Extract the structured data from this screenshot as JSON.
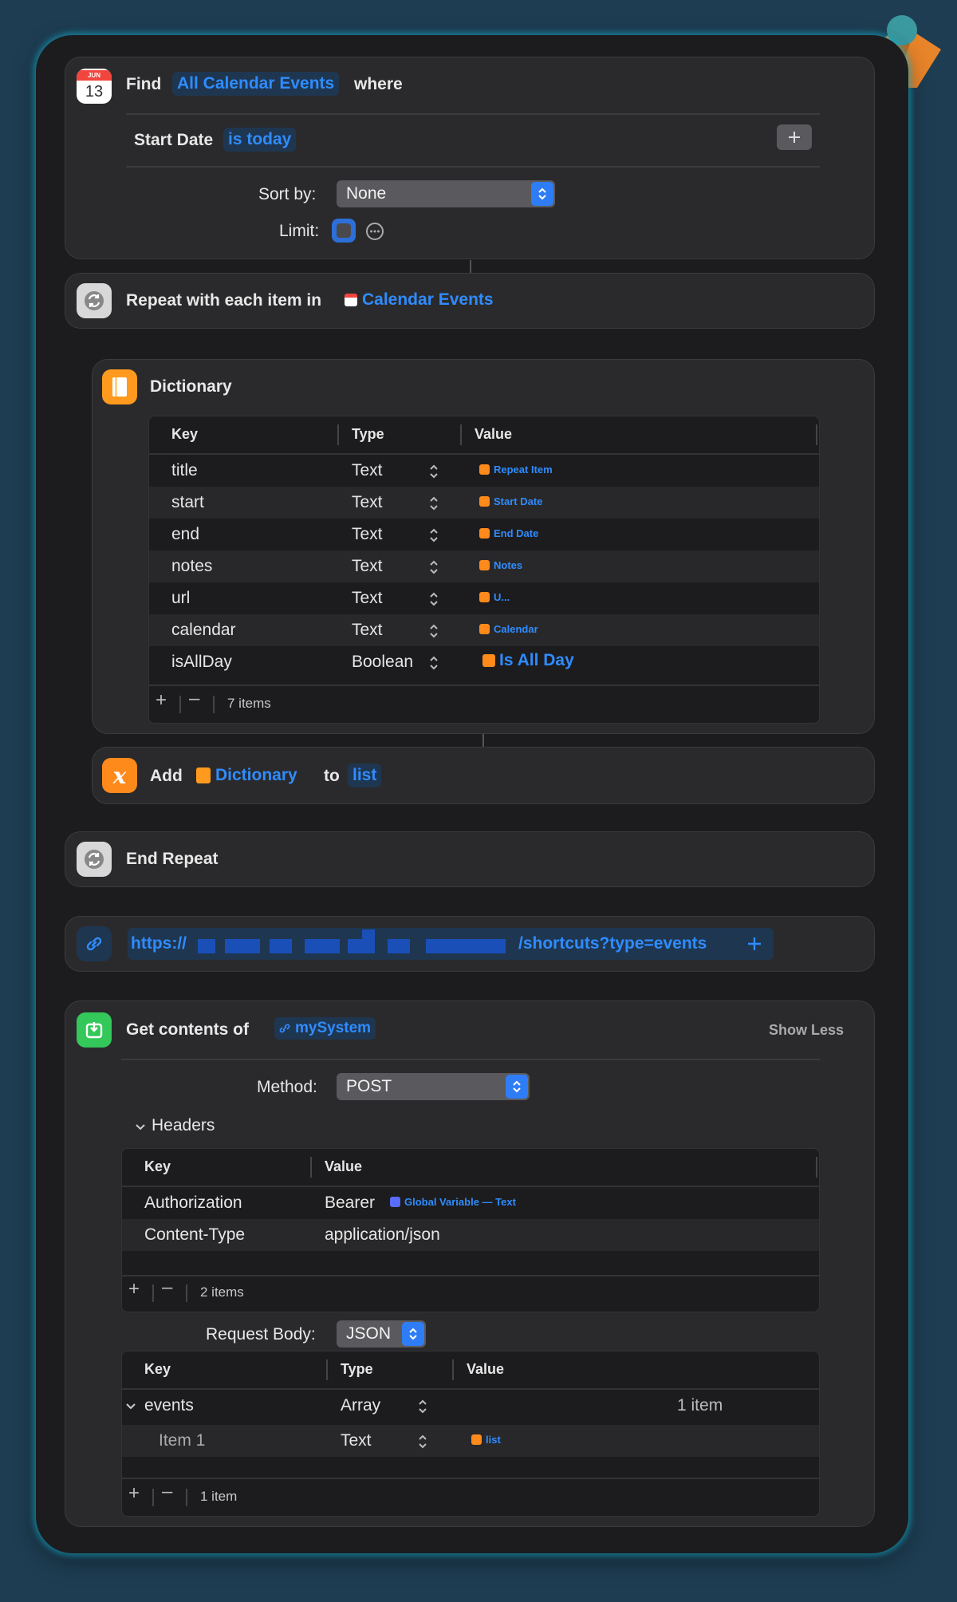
{
  "find_action": {
    "find_label": "Find",
    "entity": "All Calendar Events",
    "where_label": "where",
    "filter_field": "Start Date",
    "filter_condition": "is today",
    "sort_label": "Sort by:",
    "sort_value": "None",
    "limit_label": "Limit:",
    "calendar_month": "JUN",
    "calendar_day": "13"
  },
  "repeat_action": {
    "label": "Repeat with each item in",
    "variable": "Calendar Events"
  },
  "dictionary_action": {
    "title": "Dictionary",
    "headers": {
      "key": "Key",
      "type": "Type",
      "value": "Value"
    },
    "rows": [
      {
        "key": "title",
        "type": "Text",
        "value": "Repeat Item"
      },
      {
        "key": "start",
        "type": "Text",
        "value": "Start Date"
      },
      {
        "key": "end",
        "type": "Text",
        "value": "End Date"
      },
      {
        "key": "notes",
        "type": "Text",
        "value": "Notes"
      },
      {
        "key": "url",
        "type": "Text",
        "value": "U..."
      },
      {
        "key": "calendar",
        "type": "Text",
        "value": "Calendar"
      },
      {
        "key": "isAllDay",
        "type": "Boolean",
        "value": "Is All Day"
      }
    ],
    "count": "7 items"
  },
  "add_action": {
    "label": "Add",
    "variable": "Dictionary",
    "to_label": "to",
    "target": "list"
  },
  "end_repeat": {
    "label": "End Repeat"
  },
  "url_action": {
    "prefix": "https://",
    "suffix": "/shortcuts?type=events"
  },
  "get_contents": {
    "label": "Get contents of",
    "variable": "mySystem",
    "show_less": "Show Less",
    "method_label": "Method:",
    "method_value": "POST",
    "headers_label": "Headers",
    "headers_table": {
      "key_header": "Key",
      "value_header": "Value",
      "rows": [
        {
          "key": "Authorization",
          "value_prefix": "Bearer",
          "value_token": "Global Variable — Text"
        },
        {
          "key": "Content-Type",
          "value": "application/json"
        }
      ],
      "count": "2 items"
    },
    "body_label": "Request Body:",
    "body_value": "JSON",
    "body_table": {
      "key_header": "Key",
      "type_header": "Type",
      "value_header": "Value",
      "rows": [
        {
          "key": "events",
          "type": "Array",
          "value": "1 item"
        },
        {
          "key": "Item 1",
          "type": "Text",
          "value": "list"
        }
      ],
      "count": "1 item"
    }
  },
  "colors": {
    "accent_blue": "#2f8cff",
    "window_bg": "#1c1c1e",
    "card_bg": "#2a2a2c",
    "page_bg": "#1e3d52"
  }
}
